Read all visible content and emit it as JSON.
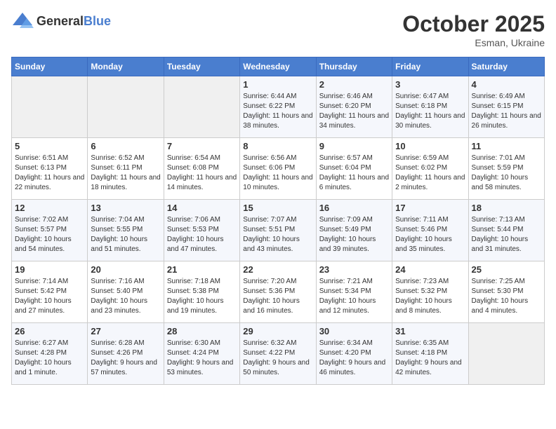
{
  "header": {
    "logo_general": "General",
    "logo_blue": "Blue",
    "title": "October 2025",
    "location": "Esman, Ukraine"
  },
  "weekdays": [
    "Sunday",
    "Monday",
    "Tuesday",
    "Wednesday",
    "Thursday",
    "Friday",
    "Saturday"
  ],
  "weeks": [
    [
      {
        "day": "",
        "info": ""
      },
      {
        "day": "",
        "info": ""
      },
      {
        "day": "",
        "info": ""
      },
      {
        "day": "1",
        "info": "Sunrise: 6:44 AM\nSunset: 6:22 PM\nDaylight: 11 hours\nand 38 minutes."
      },
      {
        "day": "2",
        "info": "Sunrise: 6:46 AM\nSunset: 6:20 PM\nDaylight: 11 hours\nand 34 minutes."
      },
      {
        "day": "3",
        "info": "Sunrise: 6:47 AM\nSunset: 6:18 PM\nDaylight: 11 hours\nand 30 minutes."
      },
      {
        "day": "4",
        "info": "Sunrise: 6:49 AM\nSunset: 6:15 PM\nDaylight: 11 hours\nand 26 minutes."
      }
    ],
    [
      {
        "day": "5",
        "info": "Sunrise: 6:51 AM\nSunset: 6:13 PM\nDaylight: 11 hours\nand 22 minutes."
      },
      {
        "day": "6",
        "info": "Sunrise: 6:52 AM\nSunset: 6:11 PM\nDaylight: 11 hours\nand 18 minutes."
      },
      {
        "day": "7",
        "info": "Sunrise: 6:54 AM\nSunset: 6:08 PM\nDaylight: 11 hours\nand 14 minutes."
      },
      {
        "day": "8",
        "info": "Sunrise: 6:56 AM\nSunset: 6:06 PM\nDaylight: 11 hours\nand 10 minutes."
      },
      {
        "day": "9",
        "info": "Sunrise: 6:57 AM\nSunset: 6:04 PM\nDaylight: 11 hours\nand 6 minutes."
      },
      {
        "day": "10",
        "info": "Sunrise: 6:59 AM\nSunset: 6:02 PM\nDaylight: 11 hours\nand 2 minutes."
      },
      {
        "day": "11",
        "info": "Sunrise: 7:01 AM\nSunset: 5:59 PM\nDaylight: 10 hours\nand 58 minutes."
      }
    ],
    [
      {
        "day": "12",
        "info": "Sunrise: 7:02 AM\nSunset: 5:57 PM\nDaylight: 10 hours\nand 54 minutes."
      },
      {
        "day": "13",
        "info": "Sunrise: 7:04 AM\nSunset: 5:55 PM\nDaylight: 10 hours\nand 51 minutes."
      },
      {
        "day": "14",
        "info": "Sunrise: 7:06 AM\nSunset: 5:53 PM\nDaylight: 10 hours\nand 47 minutes."
      },
      {
        "day": "15",
        "info": "Sunrise: 7:07 AM\nSunset: 5:51 PM\nDaylight: 10 hours\nand 43 minutes."
      },
      {
        "day": "16",
        "info": "Sunrise: 7:09 AM\nSunset: 5:49 PM\nDaylight: 10 hours\nand 39 minutes."
      },
      {
        "day": "17",
        "info": "Sunrise: 7:11 AM\nSunset: 5:46 PM\nDaylight: 10 hours\nand 35 minutes."
      },
      {
        "day": "18",
        "info": "Sunrise: 7:13 AM\nSunset: 5:44 PM\nDaylight: 10 hours\nand 31 minutes."
      }
    ],
    [
      {
        "day": "19",
        "info": "Sunrise: 7:14 AM\nSunset: 5:42 PM\nDaylight: 10 hours\nand 27 minutes."
      },
      {
        "day": "20",
        "info": "Sunrise: 7:16 AM\nSunset: 5:40 PM\nDaylight: 10 hours\nand 23 minutes."
      },
      {
        "day": "21",
        "info": "Sunrise: 7:18 AM\nSunset: 5:38 PM\nDaylight: 10 hours\nand 19 minutes."
      },
      {
        "day": "22",
        "info": "Sunrise: 7:20 AM\nSunset: 5:36 PM\nDaylight: 10 hours\nand 16 minutes."
      },
      {
        "day": "23",
        "info": "Sunrise: 7:21 AM\nSunset: 5:34 PM\nDaylight: 10 hours\nand 12 minutes."
      },
      {
        "day": "24",
        "info": "Sunrise: 7:23 AM\nSunset: 5:32 PM\nDaylight: 10 hours\nand 8 minutes."
      },
      {
        "day": "25",
        "info": "Sunrise: 7:25 AM\nSunset: 5:30 PM\nDaylight: 10 hours\nand 4 minutes."
      }
    ],
    [
      {
        "day": "26",
        "info": "Sunrise: 6:27 AM\nSunset: 4:28 PM\nDaylight: 10 hours\nand 1 minute."
      },
      {
        "day": "27",
        "info": "Sunrise: 6:28 AM\nSunset: 4:26 PM\nDaylight: 9 hours\nand 57 minutes."
      },
      {
        "day": "28",
        "info": "Sunrise: 6:30 AM\nSunset: 4:24 PM\nDaylight: 9 hours\nand 53 minutes."
      },
      {
        "day": "29",
        "info": "Sunrise: 6:32 AM\nSunset: 4:22 PM\nDaylight: 9 hours\nand 50 minutes."
      },
      {
        "day": "30",
        "info": "Sunrise: 6:34 AM\nSunset: 4:20 PM\nDaylight: 9 hours\nand 46 minutes."
      },
      {
        "day": "31",
        "info": "Sunrise: 6:35 AM\nSunset: 4:18 PM\nDaylight: 9 hours\nand 42 minutes."
      },
      {
        "day": "",
        "info": ""
      }
    ]
  ]
}
